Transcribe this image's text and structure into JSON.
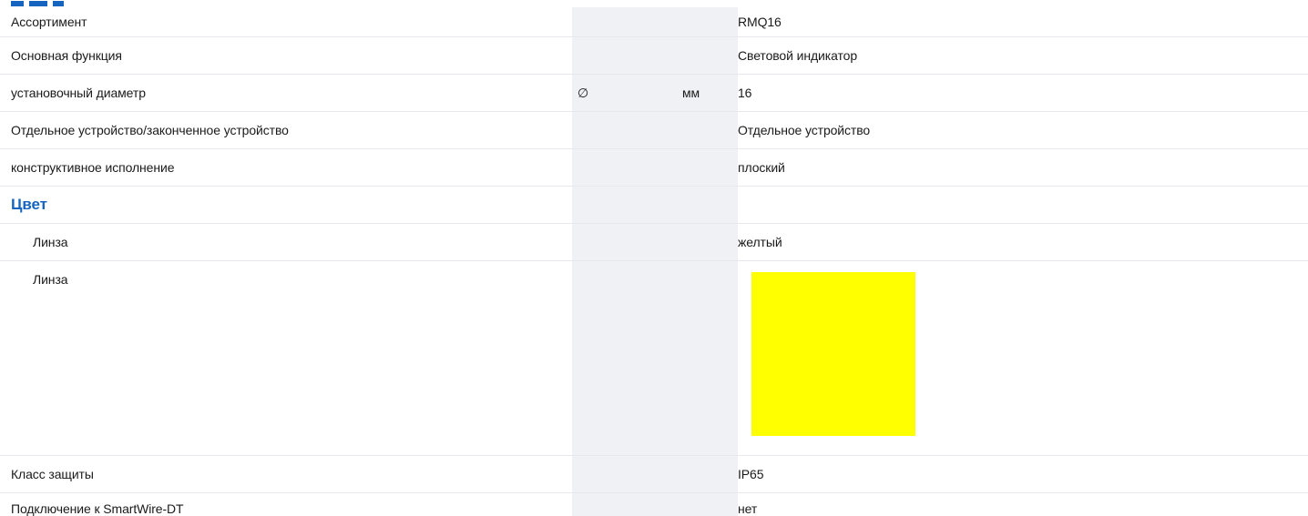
{
  "rows": [
    {
      "label": "Ассортимент",
      "symbol": "",
      "unit": "",
      "value": "RMQ16"
    },
    {
      "label": "Основная функция",
      "symbol": "",
      "unit": "",
      "value": "Световой индикатор"
    },
    {
      "label": "установочный диаметр",
      "symbol": "∅",
      "unit": "мм",
      "value": "16"
    },
    {
      "label": "Отдельное устройство/законченное устройство",
      "symbol": "",
      "unit": "",
      "value": "Отдельное устройство"
    },
    {
      "label": "конструктивное исполнение",
      "symbol": "",
      "unit": "",
      "value": "плоский"
    }
  ],
  "section_color": {
    "title": "Цвет",
    "lens_label": "Линза",
    "lens_value": "желтый",
    "lens_swatch_label": "Линза",
    "swatch_color": "#ffff00"
  },
  "rows_after": [
    {
      "label": "Класс защиты",
      "symbol": "",
      "unit": "",
      "value": "IP65"
    },
    {
      "label": "Подключение к SmartWire-DT",
      "symbol": "",
      "unit": "",
      "value": "нет"
    }
  ],
  "colors": {
    "heading": "#1565c0",
    "shaded_column": "#f0f1f5",
    "row_divider": "#e6e8ee"
  }
}
